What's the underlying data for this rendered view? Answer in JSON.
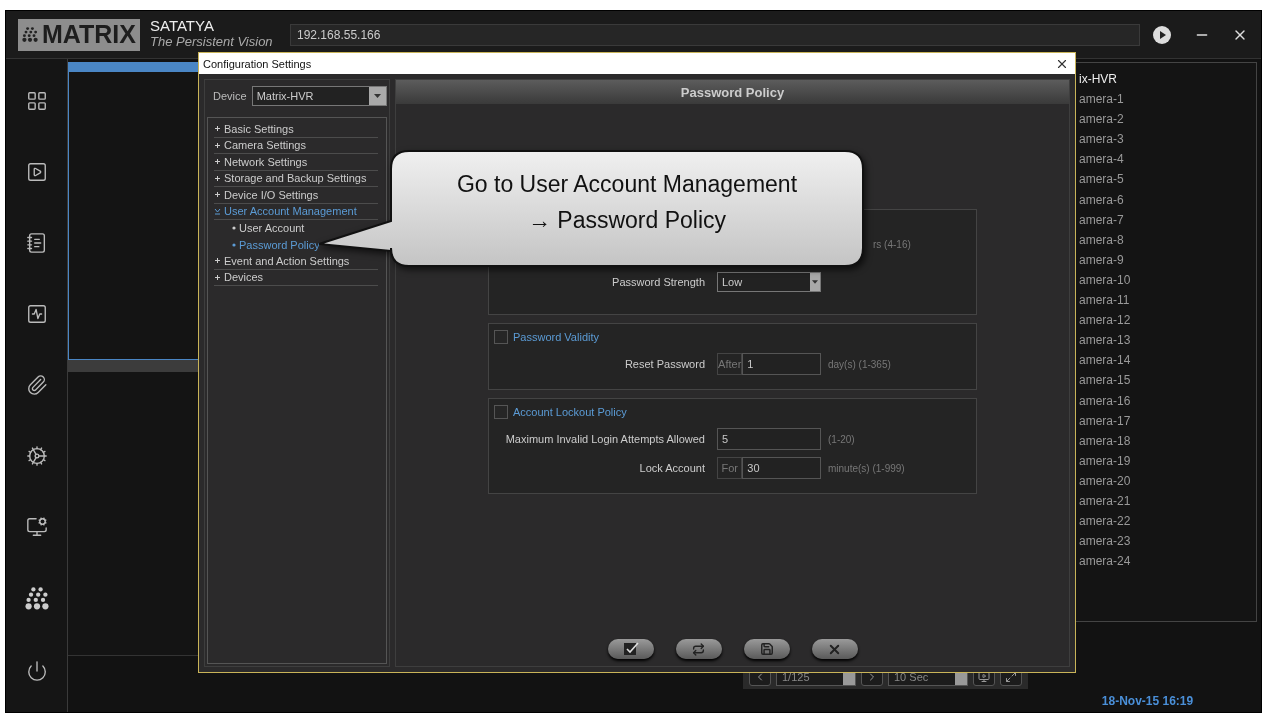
{
  "app": {
    "logo": "MATRIX",
    "product": "SATATYA",
    "tagline": "The Persistent Vision",
    "address": "192.168.55.166"
  },
  "camera_panel": {
    "device": "ix-HVR",
    "cameras": [
      "amera-1",
      "amera-2",
      "amera-3",
      "amera-4",
      "amera-5",
      "amera-6",
      "amera-7",
      "amera-8",
      "amera-9",
      "amera-10",
      "amera-11",
      "amera-12",
      "amera-13",
      "amera-14",
      "amera-15",
      "amera-16",
      "amera-17",
      "amera-18",
      "amera-19",
      "amera-20",
      "amera-21",
      "amera-22",
      "amera-23",
      "amera-24"
    ]
  },
  "player_bar": {
    "page": "1/125",
    "interval": "10 Sec"
  },
  "clock": "18-Nov-15 16:19",
  "dialog": {
    "title": "Configuration Settings",
    "device_label": "Device",
    "device": "Matrix-HVR",
    "tree": [
      {
        "label": "Basic Settings",
        "expanded": false
      },
      {
        "label": "Camera Settings",
        "expanded": false
      },
      {
        "label": "Network Settings",
        "expanded": false
      },
      {
        "label": "Storage and Backup Settings",
        "expanded": false
      },
      {
        "label": "Device I/O Settings",
        "expanded": false
      },
      {
        "label": "User Account Management",
        "expanded": true,
        "children": [
          {
            "label": "User Account",
            "selected": false
          },
          {
            "label": "Password Policy",
            "selected": true
          }
        ]
      },
      {
        "label": "Event and Action Settings",
        "expanded": false
      },
      {
        "label": "Devices",
        "expanded": false
      }
    ],
    "header": "Password Policy",
    "groups": [
      {
        "rows": [
          {
            "kind": "cut_hint",
            "hint": "rs (4-16)"
          },
          {
            "kind": "select",
            "label": "Password Strength",
            "value": "Low"
          }
        ]
      },
      {
        "title": "Password Validity",
        "checked": false,
        "rows": [
          {
            "kind": "prefixed",
            "label": "Reset Password",
            "prefix": "After",
            "value": "1",
            "hint": "day(s) (1-365)"
          }
        ]
      },
      {
        "title": "Account Lockout Policy",
        "checked": false,
        "rows": [
          {
            "kind": "input",
            "label": "Maximum Invalid Login Attempts Allowed",
            "value": "5",
            "hint": "(1-20)"
          },
          {
            "kind": "prefixed",
            "label": "Lock Account",
            "prefix": "For",
            "value": "30",
            "hint": "minute(s) (1-999)"
          }
        ]
      }
    ]
  },
  "callout": {
    "lines": [
      "Go to User Account Management",
      "→ Password Policy"
    ]
  }
}
